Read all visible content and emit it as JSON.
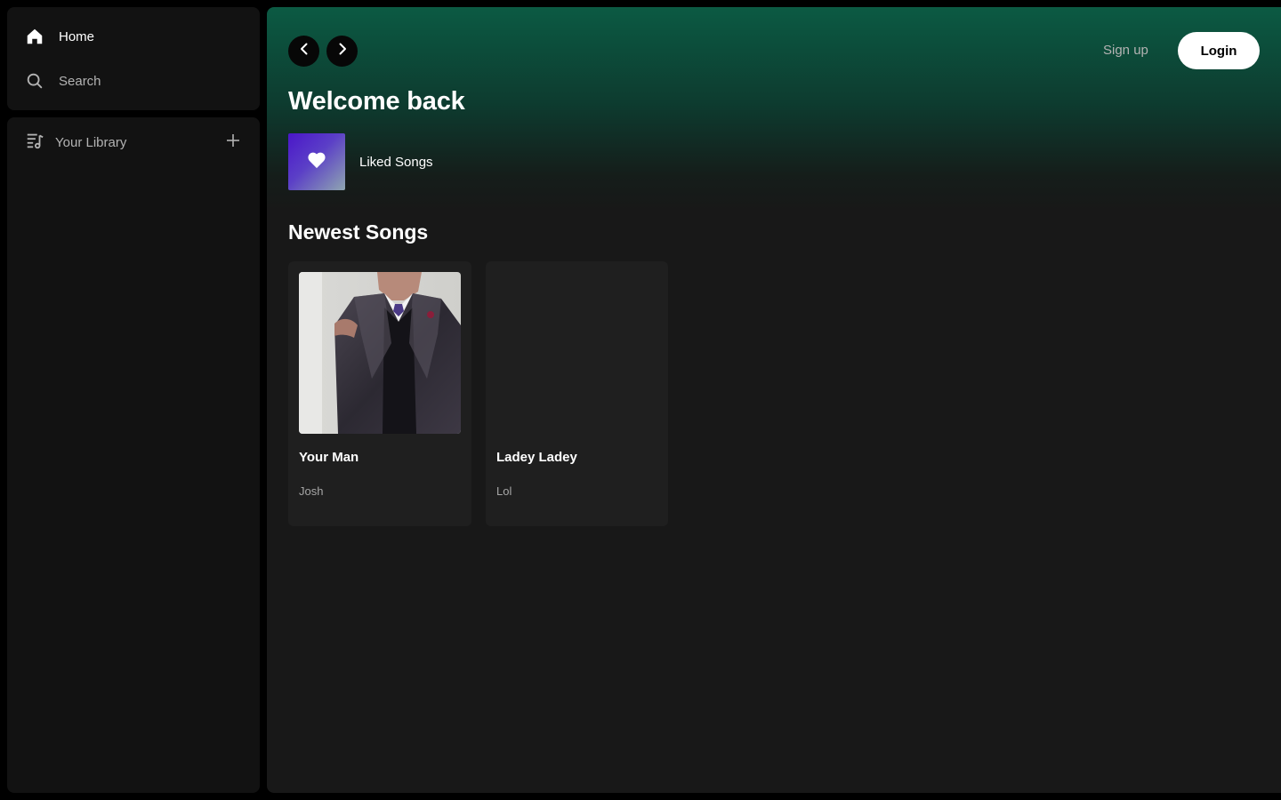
{
  "sidebar": {
    "nav": [
      {
        "label": "Home",
        "icon": "home-icon"
      },
      {
        "label": "Search",
        "icon": "search-icon"
      }
    ],
    "library": {
      "label": "Your Library",
      "icon": "library-icon",
      "add_icon": "plus-icon"
    }
  },
  "header": {
    "back_icon": "chevron-left-icon",
    "forward_icon": "chevron-right-icon",
    "signup_label": "Sign up",
    "login_label": "Login"
  },
  "main": {
    "greeting": "Welcome back",
    "liked_songs": {
      "label": "Liked Songs",
      "icon": "heart-icon"
    },
    "section_title": "Newest Songs",
    "songs": [
      {
        "title": "Your Man",
        "artist": "Josh",
        "has_cover": true
      },
      {
        "title": "Ladey Ladey",
        "artist": "Lol",
        "has_cover": false
      }
    ]
  },
  "colors": {
    "accent_gradient_top": "#0c5a43",
    "background": "#000000",
    "panel": "#121212",
    "main_bg": "#181818",
    "card_bg": "#1f1f1f",
    "muted_text": "#b3b3b3",
    "login_bg": "#ffffff"
  }
}
